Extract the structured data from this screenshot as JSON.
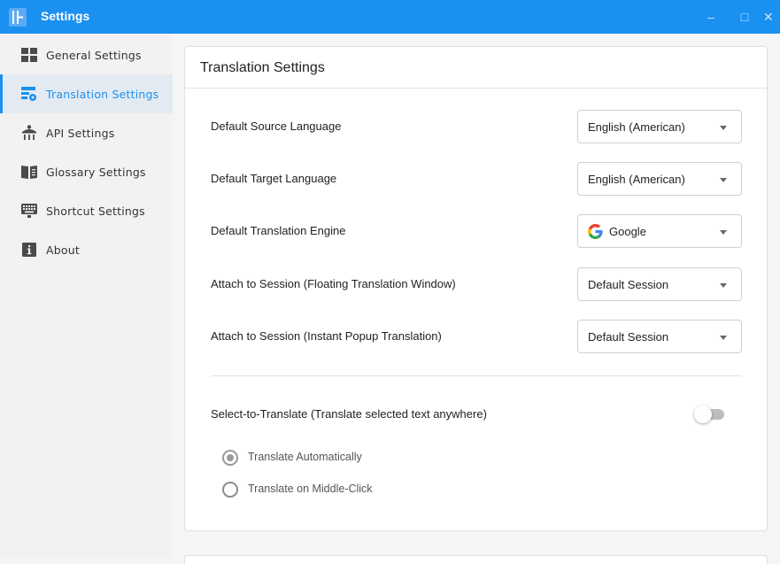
{
  "window": {
    "title": "Settings",
    "minimize": "–",
    "maximize": "□",
    "close": "✕"
  },
  "sidebar": {
    "items": [
      {
        "label": "General Settings",
        "icon": "grid-icon",
        "active": false
      },
      {
        "label": "Translation Settings",
        "icon": "translate-gear-icon",
        "active": true
      },
      {
        "label": "API Settings",
        "icon": "plug-icon",
        "active": false
      },
      {
        "label": "Glossary Settings",
        "icon": "book-icon",
        "active": false
      },
      {
        "label": "Shortcut Settings",
        "icon": "keyboard-icon",
        "active": false
      },
      {
        "label": "About",
        "icon": "info-icon",
        "active": false
      }
    ]
  },
  "card": {
    "title": "Translation Settings",
    "rows": [
      {
        "label": "Default Source Language",
        "value": "English (American)"
      },
      {
        "label": "Default Target Language",
        "value": "English (American)"
      },
      {
        "label": "Default Translation Engine",
        "value": "Google"
      },
      {
        "label": "Attach to Session (Floating Translation Window)",
        "value": "Default Session"
      },
      {
        "label": "Attach to Session (Instant Popup Translation)",
        "value": "Default Session"
      }
    ],
    "select_to_translate": {
      "label": "Select-to-Translate (Translate selected text anywhere)",
      "enabled": false
    },
    "radios": [
      {
        "label": "Translate Automatically",
        "checked": true
      },
      {
        "label": "Translate on Middle-Click",
        "checked": false
      }
    ]
  },
  "colors": {
    "accent": "#1a90f0",
    "active_bg": "#e4eaf1"
  }
}
